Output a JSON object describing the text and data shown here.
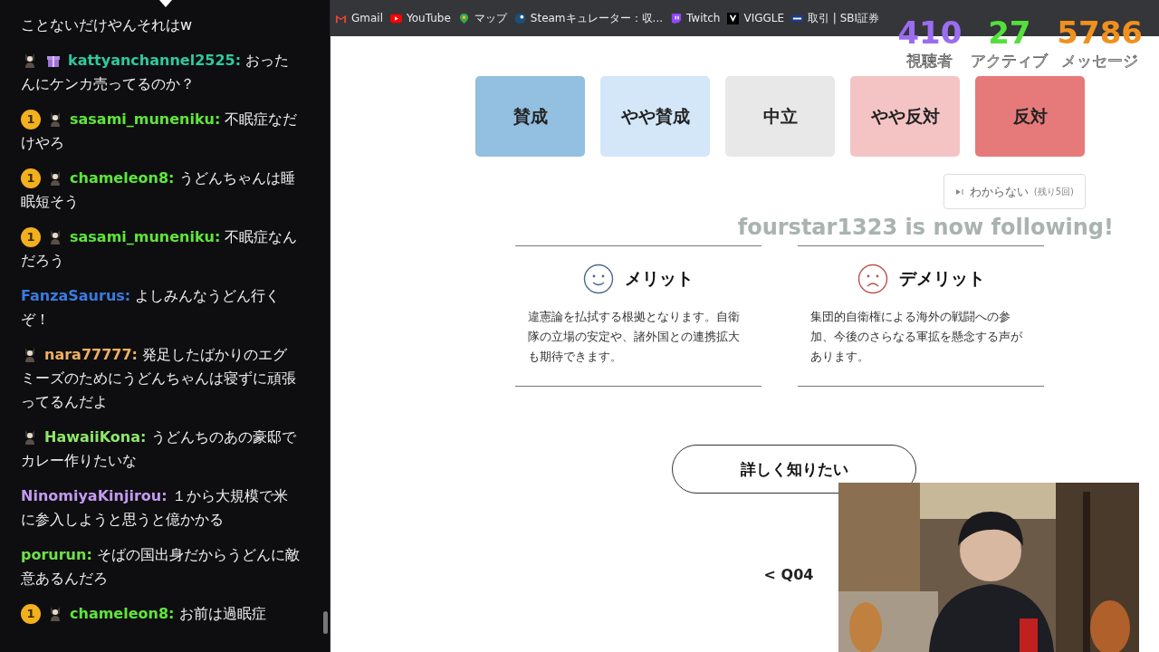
{
  "chat": {
    "messages": [
      {
        "text": "ことないだけやんそれはw"
      },
      {
        "badges": [
          {
            "kind": "avatar"
          },
          {
            "kind": "gift"
          }
        ],
        "user": "kattyanchannel2525:",
        "color": "#2fc9a0",
        "text": "おったんにケンカ売ってるのか？"
      },
      {
        "badges": [
          {
            "kind": "coin",
            "text": "1"
          },
          {
            "kind": "avatar"
          }
        ],
        "user": "sasami_muneniku:",
        "color": "#5ee63a",
        "text": "不眠症なだけやろ"
      },
      {
        "badges": [
          {
            "kind": "coin",
            "text": "1"
          },
          {
            "kind": "avatar"
          }
        ],
        "user": "chameleon8:",
        "color": "#5ee63a",
        "text": "うどんちゃんは睡眠短そう"
      },
      {
        "badges": [
          {
            "kind": "coin",
            "text": "1"
          },
          {
            "kind": "avatar"
          }
        ],
        "user": "sasami_muneniku:",
        "color": "#5ee63a",
        "text": "不眠症なんだろう"
      },
      {
        "user": "FanzaSaurus:",
        "color": "#3a7be0",
        "text": "よしみんなうどん行くぞ！"
      },
      {
        "badges": [
          {
            "kind": "avatar"
          }
        ],
        "user": "nara77777:",
        "color": "#f0b060",
        "text": "発足したばかりのエグミーズのためにうどんちゃんは寝ずに頑張ってるんだよ"
      },
      {
        "badges": [
          {
            "kind": "avatar"
          }
        ],
        "user": "HawaiiKona:",
        "color": "#8ee86a",
        "text": "うどんちのあの豪邸でカレー作りたいな"
      },
      {
        "user": "NinomiyaKinjirou:",
        "color": "#c39af0",
        "text": "１から大規模で米に参入しようと思うと億かかる"
      },
      {
        "user": "porurun:",
        "color": "#6fe04a",
        "text": "そばの国出身だからうどんに敵意あるんだろ"
      },
      {
        "badges": [
          {
            "kind": "coin",
            "text": "1"
          },
          {
            "kind": "avatar"
          }
        ],
        "user": "chameleon8:",
        "color": "#5ee63a",
        "text": "お前は過眠症"
      }
    ]
  },
  "bookmarks": [
    {
      "kind": "gmail",
      "label": "Gmail"
    },
    {
      "kind": "youtube",
      "label": "YouTube"
    },
    {
      "kind": "maps",
      "label": "マップ"
    },
    {
      "kind": "steam",
      "label": "Steamキュレーター：収..."
    },
    {
      "kind": "twitch",
      "label": "Twitch"
    },
    {
      "kind": "viggle",
      "label": "VIGGLE"
    },
    {
      "kind": "sbi",
      "label": "取引 | SBI証券"
    }
  ],
  "stats": [
    {
      "value": "410",
      "label": "視聴者",
      "color": "#9b6cf0"
    },
    {
      "value": "27",
      "label": "アクティブ",
      "color": "#52e03a"
    },
    {
      "value": "5786",
      "label": "メッセージ",
      "color": "#f0901e"
    }
  ],
  "votes": [
    {
      "label": "賛成",
      "color": "#93bfe0"
    },
    {
      "label": "やや賛成",
      "color": "#d3e7f8"
    },
    {
      "label": "中立",
      "color": "#e8e8e8"
    },
    {
      "label": "やや反対",
      "color": "#f4c4c4"
    },
    {
      "label": "反対",
      "color": "#e67a7a"
    }
  ],
  "skip_button": {
    "label": "わからない",
    "note": "(残り5回)"
  },
  "cards": [
    {
      "kind": "merit",
      "title": "メリット",
      "text": "違憲論を払拭する根拠となります。自衛隊の立場の安定や、諸外国との連携拡大も期待できます。"
    },
    {
      "kind": "demerit",
      "title": "デメリット",
      "text": "集団的自衛権による海外の戦闘への参加、今後のさらなる軍拡を懸念する声があります。"
    }
  ],
  "more_button": "詳しく知りたい",
  "back_link": "< Q04",
  "alert": {
    "line_1": "fourstar1323 is now",
    "line_2": "following!"
  }
}
